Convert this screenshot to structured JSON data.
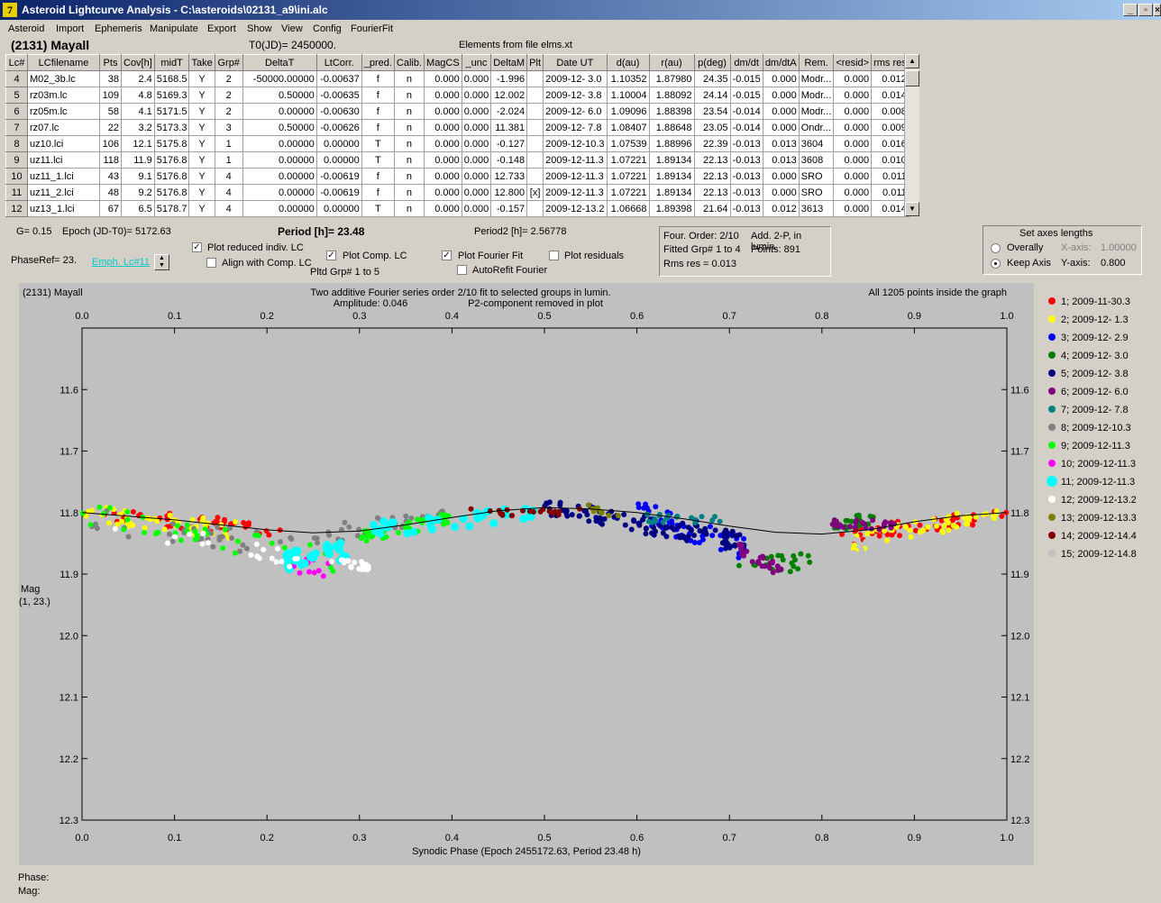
{
  "window": {
    "title": "Asteroid Lightcurve Analysis - C:\\asteroids\\02131_a9\\ini.alc",
    "min_label": "_",
    "max_label": "▫",
    "close_label": "×"
  },
  "menu": [
    "Asteroid",
    "Import",
    "Ephemeris",
    "Manipulate",
    "Export",
    "Show",
    "View",
    "Config",
    "FourierFit"
  ],
  "header": {
    "asteroid": "(2131) Mayall",
    "t0": "T0(JD)= 2450000.",
    "elements": "Elements from file elms.xt"
  },
  "table": {
    "columns": [
      "Lc#",
      "LCfilename",
      "Pts",
      "Cov[h]",
      "midT",
      "Take",
      "Grp#",
      "DeltaT",
      "LtCorr.",
      "_pred.",
      "Calib.",
      "MagCS",
      "_unc",
      "DeltaM",
      "Plt",
      "Date UT",
      "d(au)",
      "r(au)",
      "p(deg)",
      "dm/dt",
      "dm/dtA",
      "Rem.",
      "<resid>",
      "rms res"
    ],
    "rows": [
      [
        "4",
        "M02_3b.lc",
        "38",
        "2.4",
        "5168.5",
        "Y",
        "2",
        "-50000.00000",
        "-0.00637",
        "f",
        "n",
        "0.000",
        "0.000",
        "-1.996",
        "",
        "2009-12- 3.0",
        "1.10352",
        "1.87980",
        "24.35",
        "-0.015",
        "0.000",
        "Modr...",
        "0.000",
        "0.012"
      ],
      [
        "5",
        "rz03m.lc",
        "109",
        "4.8",
        "5169.3",
        "Y",
        "2",
        "0.50000",
        "-0.00635",
        "f",
        "n",
        "0.000",
        "0.000",
        "12.002",
        "",
        "2009-12- 3.8",
        "1.10004",
        "1.88092",
        "24.14",
        "-0.015",
        "0.000",
        "Modr...",
        "0.000",
        "0.014"
      ],
      [
        "6",
        "rz05m.lc",
        "58",
        "4.1",
        "5171.5",
        "Y",
        "2",
        "0.00000",
        "-0.00630",
        "f",
        "n",
        "0.000",
        "0.000",
        "-2.024",
        "",
        "2009-12- 6.0",
        "1.09096",
        "1.88398",
        "23.54",
        "-0.014",
        "0.000",
        "Modr...",
        "0.000",
        "0.008"
      ],
      [
        "7",
        "rz07.lc",
        "22",
        "3.2",
        "5173.3",
        "Y",
        "3",
        "0.50000",
        "-0.00626",
        "f",
        "n",
        "0.000",
        "0.000",
        "11.381",
        "",
        "2009-12- 7.8",
        "1.08407",
        "1.88648",
        "23.05",
        "-0.014",
        "0.000",
        "Ondr...",
        "0.000",
        "0.009"
      ],
      [
        "8",
        "uz10.lci",
        "106",
        "12.1",
        "5175.8",
        "Y",
        "1",
        "0.00000",
        "0.00000",
        "T",
        "n",
        "0.000",
        "0.000",
        "-0.127",
        "",
        "2009-12-10.3",
        "1.07539",
        "1.88996",
        "22.39",
        "-0.013",
        "0.013",
        "3604",
        "0.000",
        "0.016"
      ],
      [
        "9",
        "uz11.lci",
        "118",
        "11.9",
        "5176.8",
        "Y",
        "1",
        "0.00000",
        "0.00000",
        "T",
        "n",
        "0.000",
        "0.000",
        "-0.148",
        "",
        "2009-12-11.3",
        "1.07221",
        "1.89134",
        "22.13",
        "-0.013",
        "0.013",
        "3608",
        "0.000",
        "0.010"
      ],
      [
        "10",
        "uz11_1.lci",
        "43",
        "9.1",
        "5176.8",
        "Y",
        "4",
        "0.00000",
        "-0.00619",
        "f",
        "n",
        "0.000",
        "0.000",
        "12.733",
        "",
        "2009-12-11.3",
        "1.07221",
        "1.89134",
        "22.13",
        "-0.013",
        "0.000",
        "SRO",
        "0.000",
        "0.011"
      ],
      [
        "11",
        "uz11_2.lci",
        "48",
        "9.2",
        "5176.8",
        "Y",
        "4",
        "0.00000",
        "-0.00619",
        "f",
        "n",
        "0.000",
        "0.000",
        "12.800",
        "[x]",
        "2009-12-11.3",
        "1.07221",
        "1.89134",
        "22.13",
        "-0.013",
        "0.000",
        "SRO",
        "0.000",
        "0.011"
      ],
      [
        "12",
        "uz13_1.lci",
        "67",
        "6.5",
        "5178.7",
        "Y",
        "4",
        "0.00000",
        "0.00000",
        "T",
        "n",
        "0.000",
        "0.000",
        "-0.157",
        "",
        "2009-12-13.2",
        "1.06668",
        "1.89398",
        "21.64",
        "-0.013",
        "0.012",
        "3613",
        "0.000",
        "0.014"
      ]
    ]
  },
  "controls": {
    "g": "G= 0.15",
    "epoch": "Epoch (JD-T0)= 5172.63",
    "period_label": "Period [h]= 23.48",
    "period2": "Period2 [h]= 2.56778",
    "phase_ref": "PhaseRef= 23.",
    "emph_link": "Emph. Lc#11",
    "plot_reduced": "Plot reduced indiv. LC",
    "align_comp": "Align with Comp. LC",
    "plot_comp": "Plot Comp. LC",
    "pltd_grp": "Pltd Grp#  1   to   5",
    "plot_fourier": "Plot Fourier Fit",
    "autorefit": "AutoRefit Fourier",
    "plot_residuals": "Plot residuals",
    "four_order": "Four. Order:  2/10",
    "add_2p": "Add. 2-P, in lumin.",
    "fitted_grp": "Fitted Grp# 1 to 4",
    "points": "Points: 891",
    "rms": "Rms res     = 0.013",
    "axes_title": "Set axes lengths",
    "overally": "Overally",
    "keep_axis": "Keep Axis",
    "x_axis_label": "X-axis:",
    "x_axis_val": "1.00000",
    "y_axis_label": "Y-axis:",
    "y_axis_val": "0.800",
    "status_phase": "Phase:",
    "status_mag": "Mag:"
  },
  "chart_data": {
    "type": "scatter",
    "title_left": "(2131) Mayall",
    "title_center": "Two additive Fourier series order 2/10 fit to selected groups in lumin.",
    "amplitude": "Amplitude: 0.046",
    "p2_note": "P2-component removed in plot",
    "right_note": "All 1205 points inside the graph",
    "xlabel": "Synodic Phase (Epoch 2455172.63, Period 23.48 h)",
    "ylabel": "Mag",
    "ylabel2": "(1, 23.)",
    "xlim": [
      0,
      1
    ],
    "ylim": [
      11.5,
      12.3
    ],
    "y_inverted": true,
    "x_ticks": [
      "0.0",
      "0.1",
      "0.2",
      "0.3",
      "0.4",
      "0.5",
      "0.6",
      "0.7",
      "0.8",
      "0.9",
      "1.0"
    ],
    "y_ticks": [
      "11.6",
      "11.7",
      "11.8",
      "11.9",
      "12.0",
      "12.1",
      "12.2",
      "12.3"
    ],
    "fourier_fit": [
      [
        0.0,
        11.8
      ],
      [
        0.05,
        11.806
      ],
      [
        0.1,
        11.812
      ],
      [
        0.15,
        11.82
      ],
      [
        0.2,
        11.828
      ],
      [
        0.25,
        11.833
      ],
      [
        0.3,
        11.83
      ],
      [
        0.35,
        11.82
      ],
      [
        0.4,
        11.808
      ],
      [
        0.45,
        11.797
      ],
      [
        0.5,
        11.792
      ],
      [
        0.55,
        11.794
      ],
      [
        0.6,
        11.8
      ],
      [
        0.65,
        11.81
      ],
      [
        0.7,
        11.822
      ],
      [
        0.75,
        11.832
      ],
      [
        0.8,
        11.835
      ],
      [
        0.85,
        11.828
      ],
      [
        0.9,
        11.815
      ],
      [
        0.95,
        11.805
      ],
      [
        1.0,
        11.8
      ]
    ],
    "series": [
      {
        "name": "1; 2009-11-30.3",
        "color": "#ff0000",
        "segments": [
          [
            0.0,
            0.22,
            11.8,
            11.83,
            0.012
          ],
          [
            0.82,
            1.0,
            11.84,
            11.8,
            0.012
          ]
        ],
        "count": 90
      },
      {
        "name": "2; 2009-12- 1.3",
        "color": "#ffff00",
        "segments": [
          [
            0.0,
            0.17,
            11.8,
            11.83,
            0.015
          ],
          [
            0.83,
            0.99,
            11.85,
            11.8,
            0.014
          ]
        ],
        "count": 90
      },
      {
        "name": "3; 2009-12- 2.9",
        "color": "#0000ff",
        "segments": [
          [
            0.6,
            0.72,
            11.8,
            11.86,
            0.02
          ]
        ],
        "count": 50
      },
      {
        "name": "4; 2009-12- 3.0",
        "color": "#008000",
        "segments": [
          [
            0.71,
            0.79,
            11.89,
            11.88,
            0.015
          ],
          [
            0.81,
            0.86,
            11.82,
            11.81,
            0.01
          ]
        ],
        "count": 40
      },
      {
        "name": "5; 2009-12- 3.8",
        "color": "#000080",
        "segments": [
          [
            0.5,
            0.72,
            11.79,
            11.85,
            0.015
          ]
        ],
        "count": 110
      },
      {
        "name": "6; 2009-12- 6.0",
        "color": "#800080",
        "segments": [
          [
            0.71,
            0.76,
            11.86,
            11.9,
            0.01
          ],
          [
            0.8,
            0.88,
            11.82,
            11.82,
            0.008
          ]
        ],
        "count": 50
      },
      {
        "name": "7; 2009-12- 7.8",
        "color": "#008080",
        "segments": [
          [
            0.61,
            0.69,
            11.81,
            11.81,
            0.008
          ]
        ],
        "count": 20
      },
      {
        "name": "8; 2009-12-10.3",
        "color": "#808080",
        "segments": [
          [
            0.0,
            0.24,
            11.81,
            11.86,
            0.02
          ],
          [
            0.25,
            0.4,
            11.84,
            11.8,
            0.015
          ]
        ],
        "count": 70
      },
      {
        "name": "9; 2009-12-11.3",
        "color": "#00ff00",
        "segments": [
          [
            0.0,
            0.28,
            11.8,
            11.88,
            0.02
          ],
          [
            0.3,
            0.4,
            11.84,
            11.81,
            0.01
          ]
        ],
        "count": 80
      },
      {
        "name": "10; 2009-12-11.3",
        "color": "#ff00ff",
        "segments": [
          [
            0.22,
            0.27,
            11.89,
            11.89,
            0.015
          ]
        ],
        "count": 10
      },
      {
        "name": "11; 2009-12-11.3",
        "color": "#00ffff",
        "segments": [
          [
            0.22,
            0.29,
            11.88,
            11.86,
            0.015
          ],
          [
            0.3,
            0.49,
            11.83,
            11.8,
            0.012
          ]
        ],
        "count": 70
      },
      {
        "name": "12; 2009-12-13.2",
        "color": "#ffffff",
        "segments": [
          [
            0.0,
            0.27,
            11.81,
            11.89,
            0.015
          ],
          [
            0.28,
            0.31,
            11.88,
            11.89,
            0.008
          ]
        ],
        "count": 40
      },
      {
        "name": "13; 2009-12-13.3",
        "color": "#808000",
        "segments": [
          [
            0.52,
            0.58,
            11.79,
            11.8,
            0.008
          ]
        ],
        "count": 10
      },
      {
        "name": "14; 2009-12-14.4",
        "color": "#800000",
        "segments": [
          [
            0.42,
            0.54,
            11.8,
            11.8,
            0.006
          ]
        ],
        "count": 20
      },
      {
        "name": "15; 2009-12-14.8",
        "color": "#c0c0c0",
        "segments": [
          [
            0.82,
            0.93,
            11.85,
            11.91,
            0.02
          ]
        ],
        "count": 45
      }
    ]
  }
}
